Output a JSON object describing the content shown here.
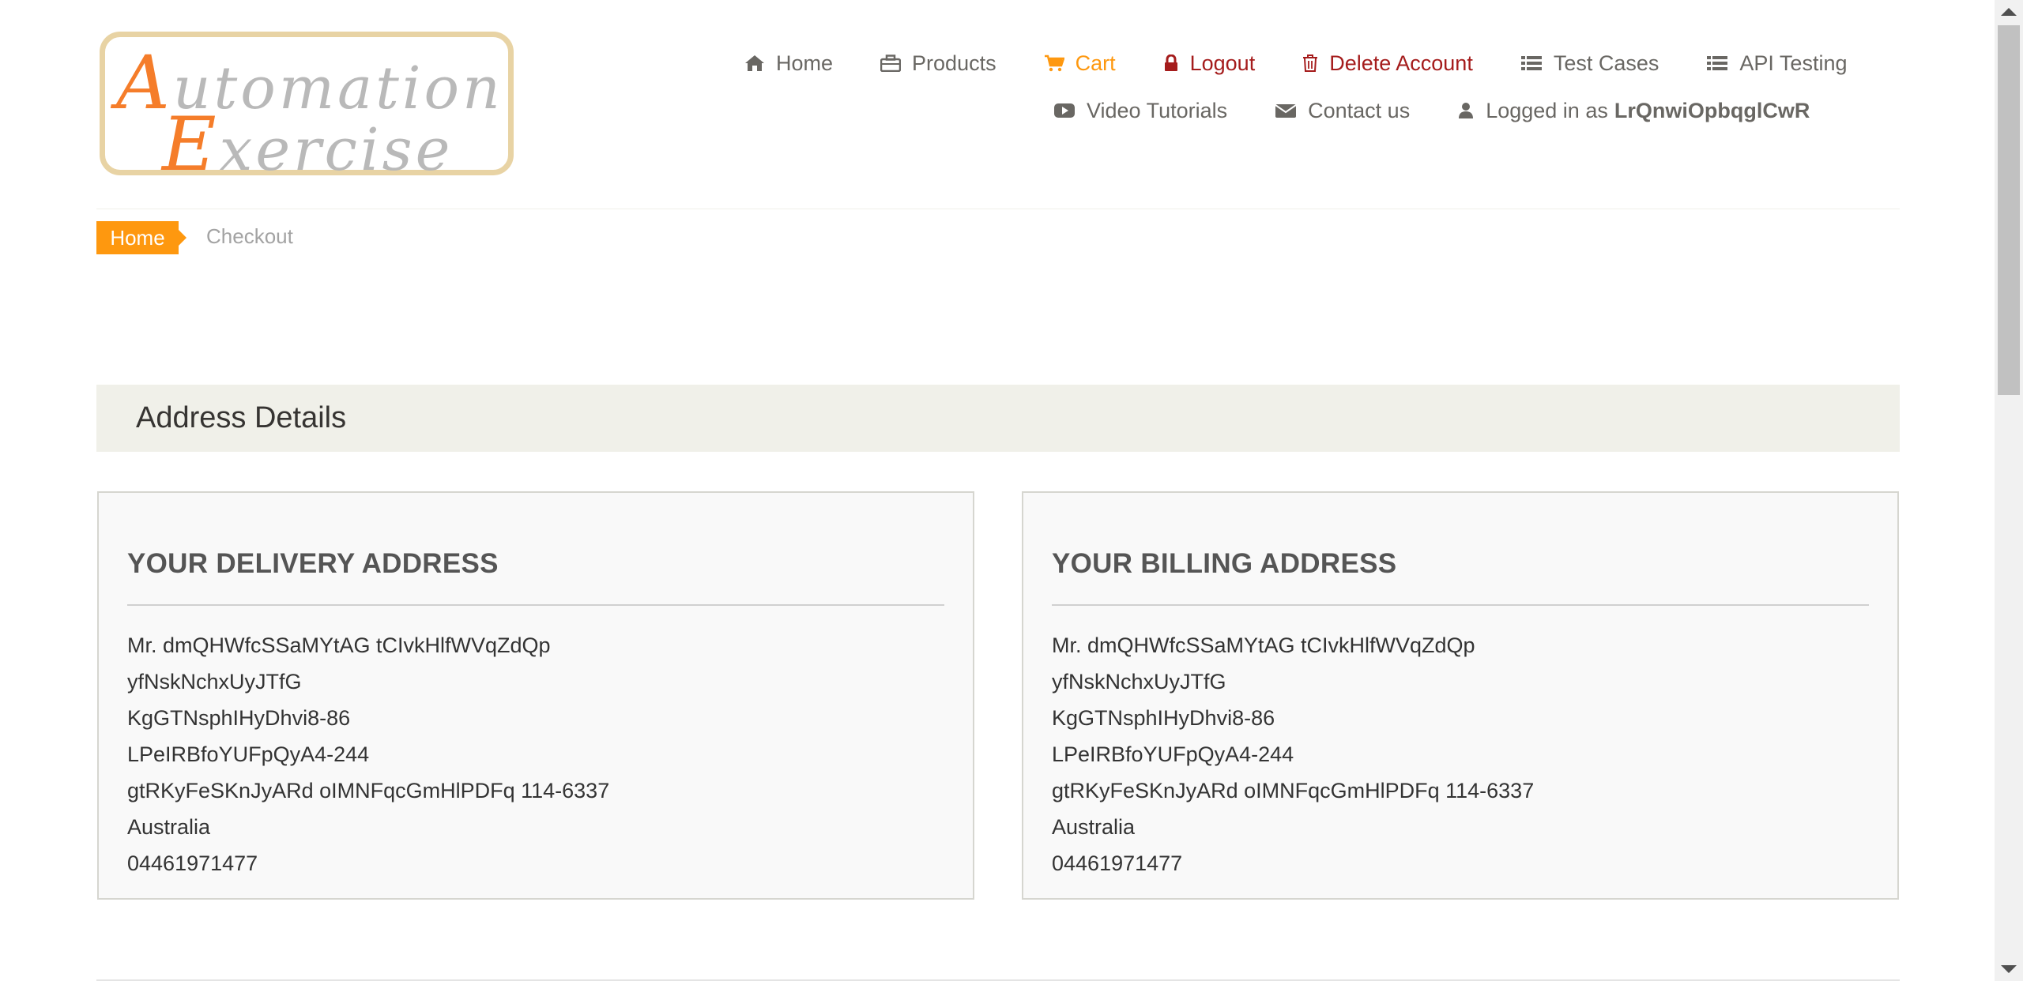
{
  "logo": {
    "line1_cap": "A",
    "line1_rest": "utomation",
    "line2_cap": "E",
    "line2_rest": "xercise"
  },
  "nav": {
    "home": {
      "label": "Home",
      "icon": "home-icon"
    },
    "products": {
      "label": "Products",
      "icon": "briefcase-icon"
    },
    "cart": {
      "label": "Cart",
      "icon": "cart-icon"
    },
    "logout": {
      "label": "Logout",
      "icon": "lock-icon"
    },
    "delete_account": {
      "label": "Delete Account",
      "icon": "trash-icon"
    },
    "test_cases": {
      "label": "Test Cases",
      "icon": "list-icon"
    },
    "api_testing": {
      "label": "API Testing",
      "icon": "list-icon"
    },
    "video_tutorials": {
      "label": "Video Tutorials",
      "icon": "youtube-play-icon"
    },
    "contact_us": {
      "label": "Contact us",
      "icon": "envelope-icon"
    },
    "logged_in_prefix": "Logged in as",
    "username": "LrQnwiOpbqglCwR"
  },
  "breadcrumb": {
    "home": "Home",
    "current": "Checkout"
  },
  "heading": "Address Details",
  "delivery": {
    "title": "YOUR DELIVERY ADDRESS",
    "lines": [
      "Mr. dmQHWfcSSaMYtAG tCIvkHlfWVqZdQp",
      "yfNskNchxUyJTfG",
      "KgGTNsphIHyDhvi8-86",
      "LPeIRBfoYUFpQyA4-244",
      "gtRKyFeSKnJyARd oIMNFqcGmHlPDFq 114-6337",
      "Australia",
      "04461971477"
    ]
  },
  "billing": {
    "title": "YOUR BILLING ADDRESS",
    "lines": [
      "Mr. dmQHWfcSSaMYtAG tCIvkHlfWVqZdQp",
      "yfNskNchxUyJTfG",
      "KgGTNsphIHyDhvi8-86",
      "LPeIRBfoYUFpQyA4-244",
      "gtRKyFeSKnJyARd oIMNFqcGmHlPDFq 114-6337",
      "Australia",
      "04461971477"
    ]
  },
  "colors": {
    "accent": "#fe980f",
    "danger": "#a51c1c",
    "nav_text": "#696763",
    "heading_bg": "#f0f0e9"
  }
}
